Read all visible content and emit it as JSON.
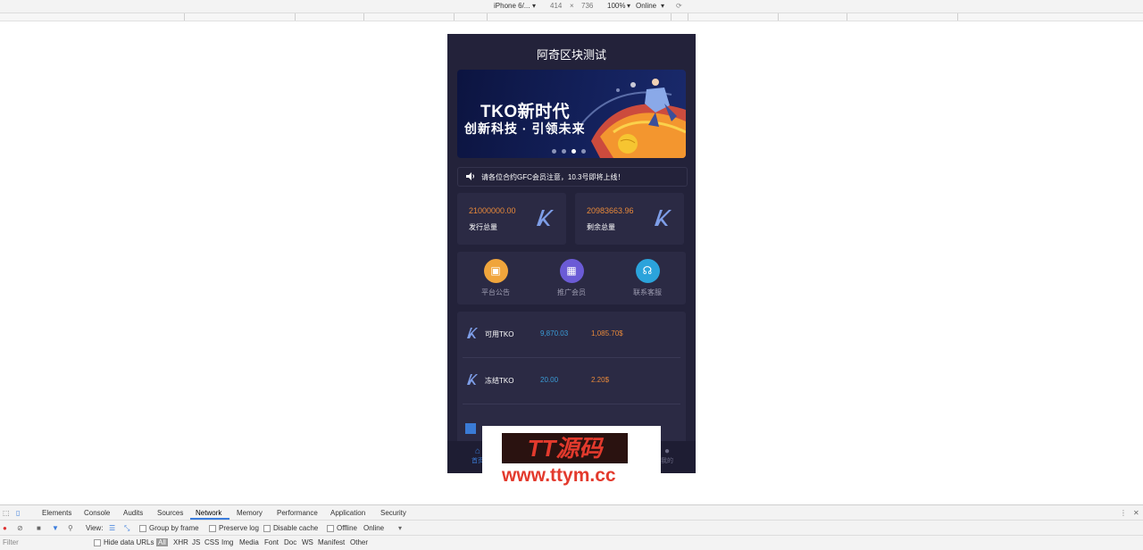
{
  "device_toolbar": {
    "device": "iPhone 6/...",
    "width": "414",
    "times": "×",
    "height": "736",
    "zoom": "100%",
    "network": "Online"
  },
  "app": {
    "title": "阿奇区块测试",
    "banner": {
      "line1": "TKO新时代",
      "line2": "创新科技 · 引领未来",
      "dots": 4,
      "active_dot": 3
    },
    "notice": "请各位合约GFC会员注意，10.3号即将上线！",
    "stats": [
      {
        "value": "21000000.00",
        "label": "发行总量"
      },
      {
        "value": "20983663.96",
        "label": "剩余总量"
      }
    ],
    "quick_links": [
      {
        "label": "平台公告",
        "icon": "briefcase-icon",
        "color": "#f0a53c"
      },
      {
        "label": "推广会员",
        "icon": "qrcode-icon",
        "color": "#6b5bd6"
      },
      {
        "label": "联系客服",
        "icon": "headset-icon",
        "color": "#2ba3db"
      }
    ],
    "assets": [
      {
        "name": "可用TKO",
        "amount": "9,870.03",
        "usd": "1,085.70$"
      },
      {
        "name": "冻结TKO",
        "amount": "20.00",
        "usd": "2.20$"
      }
    ],
    "tabbar": {
      "home": "首页",
      "mine": "我的"
    }
  },
  "watermark": {
    "title": "TT源码",
    "url": "www.ttym.cc"
  },
  "devtools": {
    "tabs": [
      "Elements",
      "Console",
      "Audits",
      "Sources",
      "Network",
      "Memory",
      "Performance",
      "Application",
      "Security"
    ],
    "active_tab": "Network",
    "toolbar": {
      "view": "View:",
      "group_by_frame": "Group by frame",
      "preserve_log": "Preserve log",
      "disable_cache": "Disable cache",
      "offline": "Offline",
      "throttle": "Online"
    },
    "filter": {
      "placeholder": "Filter",
      "hide_data_urls": "Hide data URLs",
      "types": [
        "All",
        "XHR",
        "JS",
        "CSS",
        "Img",
        "Media",
        "Font",
        "Doc",
        "WS",
        "Manifest",
        "Other"
      ]
    }
  }
}
